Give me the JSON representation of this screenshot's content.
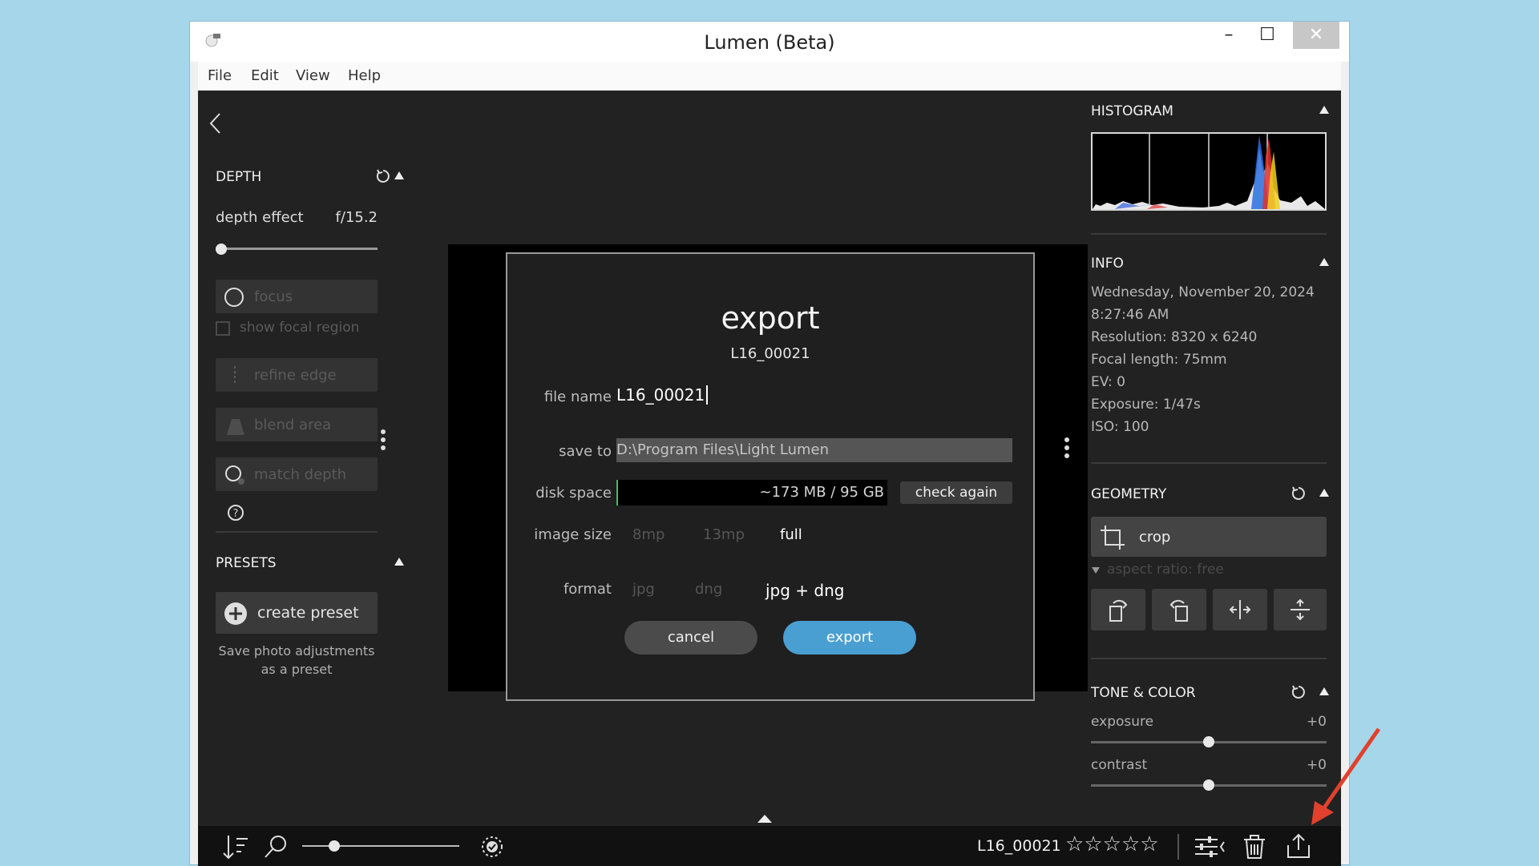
{
  "window": {
    "title": "Lumen (Beta)",
    "min_label": "–",
    "max_label": "☐",
    "close_label": "✕"
  },
  "menu": [
    "File",
    "Edit",
    "View",
    "Help"
  ],
  "left_panel": {
    "depth": {
      "title": "DEPTH",
      "effect_label": "depth effect",
      "effect_value": "f/15.2",
      "slider_value": 0.03,
      "tools": [
        "focus",
        "refine edge",
        "blend area",
        "match depth"
      ],
      "show_focal_region": "show focal region"
    },
    "presets": {
      "title": "PRESETS",
      "create_label": "create preset",
      "help_text": "Save photo adjustments as a preset"
    }
  },
  "dialog": {
    "title": "export",
    "subtitle": "L16_00021",
    "file_name_label": "file name",
    "file_name_value": "L16_00021",
    "save_to_label": "save to",
    "save_to_value": "D:\\Program Files\\Light Lumen",
    "disk_space_label": "disk space",
    "disk_space_value": "~173 MB / 95 GB",
    "check_again_label": "check again",
    "image_size_label": "image size",
    "image_size_options": [
      "8mp",
      "13mp",
      "full"
    ],
    "image_size_selected": "full",
    "format_label": "format",
    "format_options": [
      "jpg",
      "dng",
      "jpg + dng"
    ],
    "format_selected": "jpg + dng",
    "cancel_label": "cancel",
    "export_label": "export",
    "accent_color": "#4a9fd2"
  },
  "right_panel": {
    "histogram_title": "HISTOGRAM",
    "info_title": "INFO",
    "info_lines": [
      "Wednesday, November 20, 2024",
      "8:27:46 AM",
      "Resolution: 8320 x 6240",
      "Focal length: 75mm",
      "EV: 0",
      "Exposure: 1/47s",
      "ISO: 100"
    ],
    "geometry_title": "GEOMETRY",
    "crop_label": "crop",
    "aspect_ratio_label": "aspect ratio: free",
    "tone_title": "TONE & COLOR",
    "exposure_label": "exposure",
    "exposure_value": "+0",
    "contrast_label": "contrast",
    "contrast_value": "+0"
  },
  "bottom_bar": {
    "file_name": "L16_00021",
    "rating": 0,
    "rating_max": 5,
    "zoom_value": 0.2
  },
  "annotation": {
    "arrow_color": "#e0412c"
  }
}
